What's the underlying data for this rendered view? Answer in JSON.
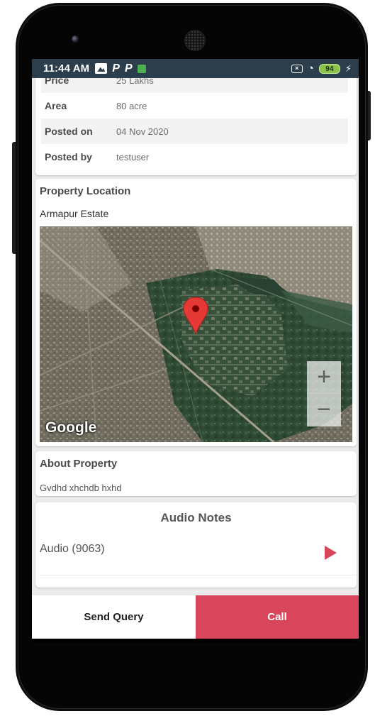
{
  "status_bar": {
    "time": "11:44 AM",
    "notif_p1": "P",
    "notif_p2": "P",
    "battery": "94"
  },
  "details": {
    "rows": [
      {
        "label": "Price",
        "value": "25 Lakhs"
      },
      {
        "label": "Area",
        "value": "80 acre"
      },
      {
        "label": "Posted on",
        "value": "04 Nov 2020"
      },
      {
        "label": "Posted by",
        "value": "testuser"
      }
    ]
  },
  "location": {
    "title": "Property Location",
    "name": "Armapur Estate",
    "map": {
      "attribution": "Google",
      "zoom_in": "+",
      "zoom_out": "−"
    }
  },
  "about": {
    "title": "About Property",
    "text": "Gvdhd xhchdb hxhd"
  },
  "audio": {
    "title": "Audio Notes",
    "items": [
      {
        "label": "Audio (9063)"
      }
    ]
  },
  "actions": {
    "send_query": "Send Query",
    "call": "Call"
  },
  "colors": {
    "accent": "#d9455a",
    "status_bar": "#2c3d4c",
    "battery": "#8bc34a"
  }
}
